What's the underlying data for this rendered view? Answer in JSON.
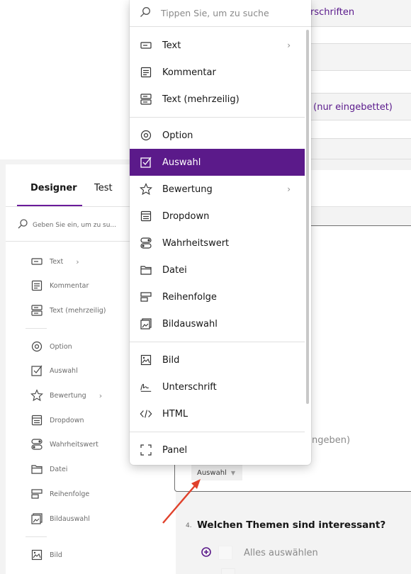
{
  "background": {
    "row1_text": "erschriften",
    "row2_text": "e (nur eingebettet)"
  },
  "designer": {
    "tabs": [
      "Designer",
      "Test"
    ],
    "search_placeholder": "Geben Sie ein, um zu su...",
    "toolbox": [
      {
        "label": "Text",
        "icon": "text-icon",
        "has_submenu": true
      },
      {
        "label": "Kommentar",
        "icon": "comment-icon"
      },
      {
        "label": "Text (mehrzeilig)",
        "icon": "multiline-text-icon"
      },
      {
        "label": "Option",
        "icon": "radio-icon"
      },
      {
        "label": "Auswahl",
        "icon": "checkbox-icon"
      },
      {
        "label": "Bewertung",
        "icon": "star-icon",
        "has_submenu": true
      },
      {
        "label": "Dropdown",
        "icon": "dropdown-icon"
      },
      {
        "label": "Wahrheitswert",
        "icon": "toggle-icon"
      },
      {
        "label": "Datei",
        "icon": "folder-icon"
      },
      {
        "label": "Reihenfolge",
        "icon": "ranking-icon"
      },
      {
        "label": "Bildauswahl",
        "icon": "image-picker-icon"
      },
      {
        "label": "Bild",
        "icon": "image-icon"
      }
    ]
  },
  "question": {
    "partial_text": "ngeben)",
    "type_selector": "Auswahl",
    "next_number": "4.",
    "next_title": "Welchen Themen sind interessant?",
    "select_all_label": "Alles auswählen"
  },
  "popup": {
    "search_placeholder": "Tippen Sie, um zu suche",
    "selected": "Auswahl",
    "items": [
      {
        "label": "Text",
        "icon": "text-icon",
        "has_submenu": true
      },
      {
        "label": "Kommentar",
        "icon": "comment-icon"
      },
      {
        "label": "Text (mehrzeilig)",
        "icon": "multiline-text-icon"
      },
      {
        "label": "Option",
        "icon": "radio-icon"
      },
      {
        "label": "Auswahl",
        "icon": "checkbox-icon"
      },
      {
        "label": "Bewertung",
        "icon": "star-icon",
        "has_submenu": true
      },
      {
        "label": "Dropdown",
        "icon": "dropdown-icon"
      },
      {
        "label": "Wahrheitswert",
        "icon": "toggle-icon"
      },
      {
        "label": "Datei",
        "icon": "folder-icon"
      },
      {
        "label": "Reihenfolge",
        "icon": "ranking-icon"
      },
      {
        "label": "Bildauswahl",
        "icon": "image-picker-icon"
      },
      {
        "label": "Bild",
        "icon": "image-icon"
      },
      {
        "label": "Unterschrift",
        "icon": "signature-icon"
      },
      {
        "label": "HTML",
        "icon": "code-icon"
      },
      {
        "label": "Panel",
        "icon": "panel-icon"
      }
    ]
  },
  "colors": {
    "accent": "#5b1a8a",
    "arrow": "#e0412b"
  }
}
